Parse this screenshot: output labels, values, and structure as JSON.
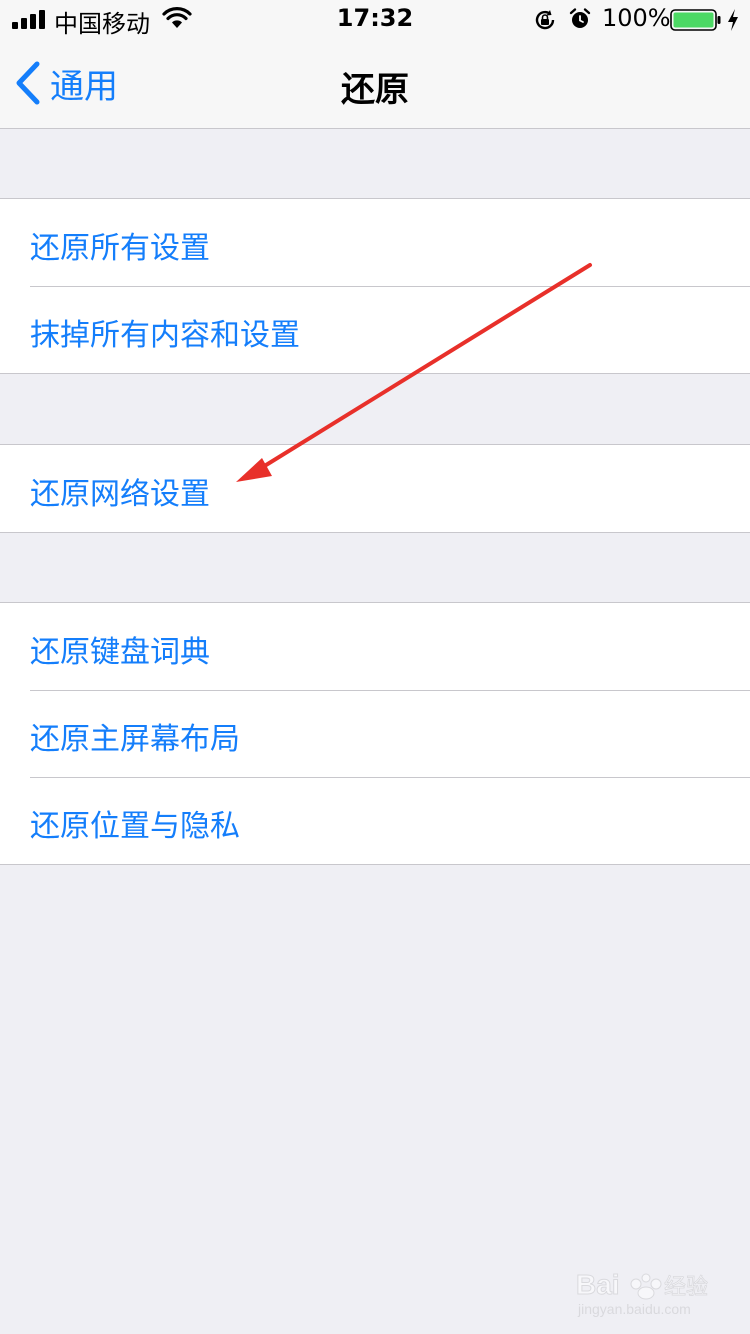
{
  "status_bar": {
    "carrier": "中国移动",
    "time": "17:32",
    "battery_percent": "100%",
    "battery_level": 1.0,
    "battery_color": "#4cd964",
    "icons": [
      "signal-icon",
      "wifi-icon",
      "lock-rotation-icon",
      "alarm-icon",
      "battery-icon",
      "charging-icon"
    ]
  },
  "nav": {
    "back_label": "通用",
    "title": "还原",
    "accent_color": "#147efb"
  },
  "groups": [
    {
      "items": [
        "还原所有设置",
        "抹掉所有内容和设置"
      ]
    },
    {
      "items": [
        "还原网络设置"
      ]
    },
    {
      "items": [
        "还原键盘词典",
        "还原主屏幕布局",
        "还原位置与隐私"
      ]
    }
  ],
  "annotation": {
    "type": "red-arrow",
    "color": "#e8302a",
    "target": "还原网络设置"
  },
  "watermark": {
    "brand": "Bai",
    "brand_cn": "经验",
    "url": "jingyan.baidu.com"
  }
}
